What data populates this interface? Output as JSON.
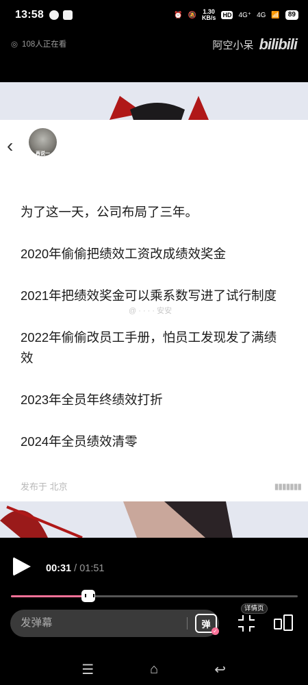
{
  "status_bar": {
    "time": "13:58",
    "speed_value": "1.30",
    "speed_unit": "KB/s",
    "hd_label": "HD",
    "sim1": "4G⁺",
    "sim2": "4G",
    "battery": "89"
  },
  "header": {
    "viewer_count": "108人正在看",
    "uploader_name": "阿空小呆",
    "logo_text": "bilibili"
  },
  "post": {
    "avatar_caption": "再说一",
    "lines": [
      "为了这一天，公司布局了三年。",
      "2020年偷偷把绩效工资改成绩效奖金",
      "2021年把绩效奖金可以乘系数写进了试行制度",
      "2022年偷偷改员工手册，怕员工发现发了满绩效",
      "2023年全员年终绩效打折",
      "2024年全员绩效清零"
    ],
    "location": "发布于 北京",
    "watermark": "@ · · · · 安安"
  },
  "player": {
    "current_time": "00:31",
    "separator": "/",
    "total_time": "01:51",
    "progress": 0.27,
    "danmaku_placeholder": "发弹幕",
    "danmaku_toggle_label": "弹",
    "detail_label": "详情页"
  },
  "colors": {
    "accent": "#fb7299",
    "background": "#000000"
  },
  "icons": [
    "eye-icon",
    "play-icon",
    "fullscreen-icon",
    "detail-page-icon",
    "menu-icon",
    "home-icon",
    "back-icon"
  ]
}
